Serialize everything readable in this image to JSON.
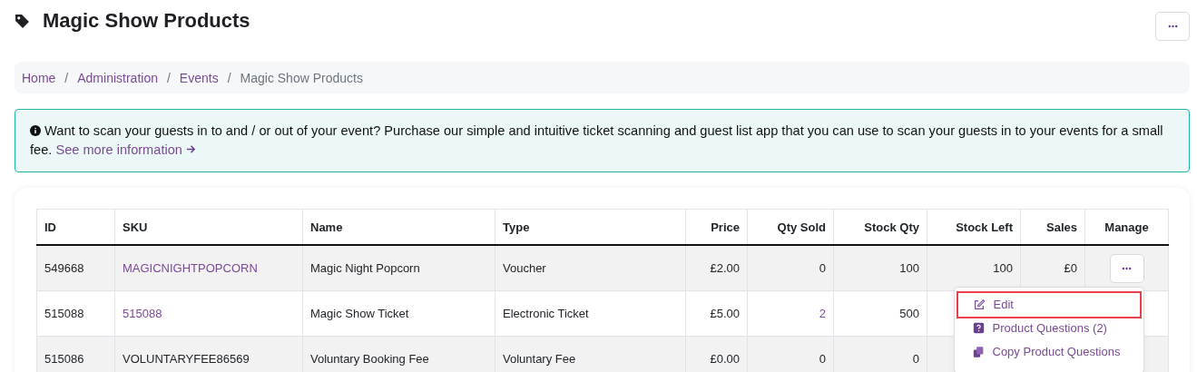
{
  "page": {
    "title": "Magic Show Products"
  },
  "breadcrumb": [
    {
      "label": "Home",
      "current": false
    },
    {
      "separator": "/",
      "label": "Administration",
      "current": false
    },
    {
      "separator": "/",
      "label": "Events",
      "current": false
    },
    {
      "separator": "/",
      "label": "Magic Show Products",
      "current": true
    }
  ],
  "alert": {
    "text": "Want to scan your guests in to and / or out of your event? Purchase our simple and intuitive ticket scanning and guest list app that you can use to scan your guests in to your events for a small fee.",
    "link": "See more information"
  },
  "table": {
    "columns": [
      {
        "label": "ID",
        "kind": "text"
      },
      {
        "label": "SKU",
        "kind": "text"
      },
      {
        "label": "Name",
        "kind": "text"
      },
      {
        "label": "Type",
        "kind": "text"
      },
      {
        "label": "Price",
        "kind": "number"
      },
      {
        "label": "Qty Sold",
        "kind": "number"
      },
      {
        "label": "Stock Qty",
        "kind": "number"
      },
      {
        "label": "Stock Left",
        "kind": "number"
      },
      {
        "label": "Sales",
        "kind": "number"
      },
      {
        "label": "Manage",
        "kind": "action"
      }
    ],
    "rows": [
      {
        "menu_button": true,
        "cells": [
          {
            "text": "549668",
            "link": false
          },
          {
            "text": "MAGICNIGHTPOPCORN",
            "link": true
          },
          {
            "text": "Magic Night Popcorn",
            "link": false
          },
          {
            "text": "Voucher",
            "link": false
          },
          {
            "text": "£2.00",
            "link": false
          },
          {
            "text": "0",
            "link": false
          },
          {
            "text": "100",
            "link": false
          },
          {
            "text": "100",
            "link": false
          },
          {
            "text": "£0",
            "link": false
          }
        ]
      },
      {
        "menu_button": false,
        "cells": [
          {
            "text": "515088",
            "link": false
          },
          {
            "text": "515088",
            "link": true
          },
          {
            "text": "Magic Show Ticket",
            "link": false
          },
          {
            "text": "Electronic Ticket",
            "link": false
          },
          {
            "text": "£5.00",
            "link": false
          },
          {
            "text": "2",
            "link": true
          },
          {
            "text": "500",
            "link": false
          }
        ]
      },
      {
        "menu_button": false,
        "cells": [
          {
            "text": "515086",
            "link": false
          },
          {
            "text": "VOLUNTARYFEE86569",
            "link": false
          },
          {
            "text": "Voluntary Booking Fee",
            "link": false
          },
          {
            "text": "Voluntary Fee",
            "link": false
          },
          {
            "text": "£0.00",
            "link": false
          },
          {
            "text": "0",
            "link": false
          },
          {
            "text": "0",
            "link": false
          }
        ]
      }
    ]
  },
  "menu": [
    {
      "kind": "edit",
      "label": "Edit",
      "highlighted": true
    },
    {
      "kind": "question",
      "label": "Product Questions (2)",
      "highlighted": false
    },
    {
      "kind": "copy",
      "label": "Copy Product Questions",
      "highlighted": false
    }
  ]
}
